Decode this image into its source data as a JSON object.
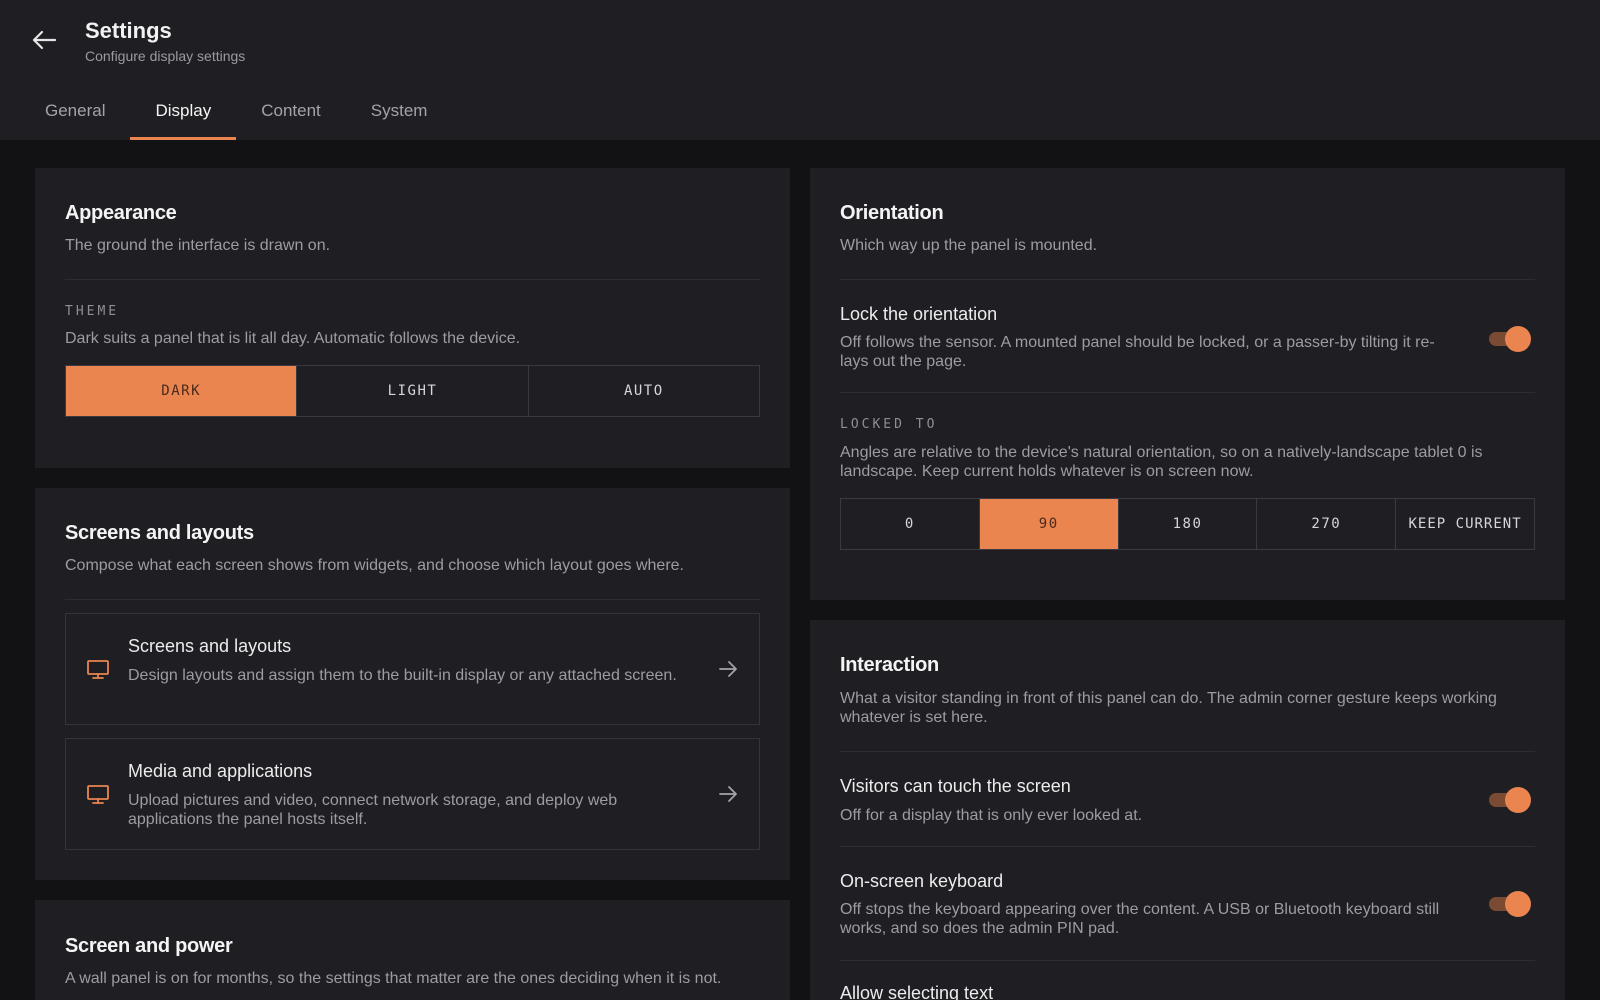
{
  "header": {
    "title": "Settings",
    "subtitle": "Configure display settings",
    "tabs": [
      {
        "label": "General"
      },
      {
        "label": "Display",
        "active": true
      },
      {
        "label": "Content"
      },
      {
        "label": "System"
      }
    ]
  },
  "appearance": {
    "title": "Appearance",
    "desc": "The ground the interface is drawn on.",
    "theme_label": "THEME",
    "theme_desc": "Dark suits a panel that is lit all day. Automatic follows the device.",
    "options": [
      "DARK",
      "LIGHT",
      "AUTO"
    ],
    "selected": "DARK"
  },
  "screens": {
    "title": "Screens and layouts",
    "desc": "Compose what each screen shows from widgets, and choose which layout goes where.",
    "items": [
      {
        "title": "Screens and layouts",
        "desc": "Design layouts and assign them to the built-in display or any attached screen.",
        "icon": "monitor-icon"
      },
      {
        "title": "Media and applications",
        "desc": "Upload pictures and video, connect network storage, and deploy web applications the panel hosts itself.",
        "icon": "monitor-icon"
      }
    ]
  },
  "power": {
    "title": "Screen and power",
    "desc": "A wall panel is on for months, so the settings that matter are the ones deciding when it is not."
  },
  "orientation": {
    "title": "Orientation",
    "desc": "Which way up the panel is mounted.",
    "lock_title": "Lock the orientation",
    "lock_desc": "Off follows the sensor. A mounted panel should be locked, or a passer-by tilting it re-lays out the page.",
    "lock_on": true,
    "locked_label": "LOCKED TO",
    "locked_desc": "Angles are relative to the device's natural orientation, so on a natively-landscape tablet 0 is landscape. Keep current holds whatever is on screen now.",
    "options": [
      "0",
      "90",
      "180",
      "270",
      "KEEP CURRENT"
    ],
    "selected": "90"
  },
  "interaction": {
    "title": "Interaction",
    "desc": "What a visitor standing in front of this panel can do. The admin corner gesture keeps working whatever is set here.",
    "rows": [
      {
        "title": "Visitors can touch the screen",
        "desc": "Off for a display that is only ever looked at.",
        "on": true
      },
      {
        "title": "On-screen keyboard",
        "desc": "Off stops the keyboard appearing over the content. A USB or Bluetooth keyboard still works, and so does the admin PIN pad.",
        "on": true
      },
      {
        "title": "Allow selecting text",
        "desc": ""
      }
    ]
  },
  "colors": {
    "accent": "#ea8550",
    "background": "#121214",
    "card": "#1f1f23"
  }
}
